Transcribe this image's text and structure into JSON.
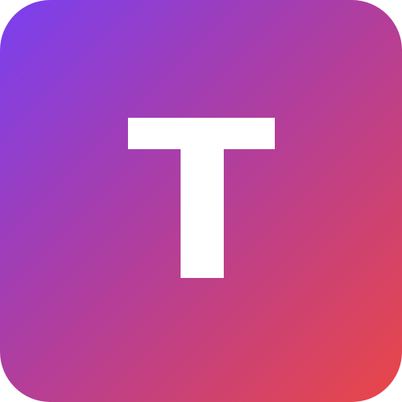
{
  "icon": {
    "letter": "T",
    "colors": {
      "gradient_start": "#7a3ff0",
      "gradient_mid": "#b33e9a",
      "gradient_end": "#ea4646",
      "glyph": "#ffffff"
    },
    "icon_name": "letter-t-app-icon"
  }
}
